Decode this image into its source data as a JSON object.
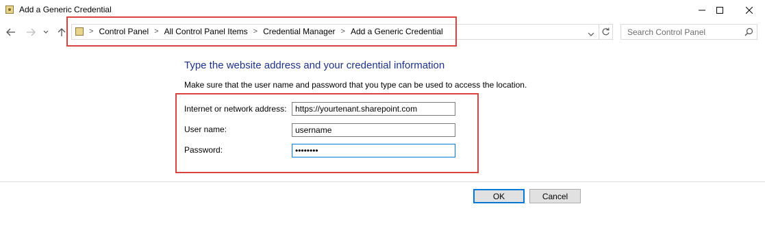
{
  "window": {
    "title": "Add a Generic Credential"
  },
  "nav": {
    "back_icon": "arrow-left-icon",
    "forward_icon": "arrow-right-icon",
    "recent_icon": "chevron-down-icon",
    "up_icon": "arrow-up-icon"
  },
  "breadcrumb": {
    "items": [
      "Control Panel",
      "All Control Panel Items",
      "Credential Manager",
      "Add a Generic Credential"
    ],
    "separator": ">"
  },
  "search": {
    "placeholder": "Search Control Panel"
  },
  "form": {
    "heading": "Type the website address and your credential information",
    "instruction": "Make sure that the user name and password that you type can be used to access the location.",
    "address_label": "Internet or network address:",
    "address_value": "https://yourtenant.sharepoint.com",
    "username_label": "User name:",
    "username_value": "username",
    "password_label": "Password:",
    "password_value": "••••••••"
  },
  "buttons": {
    "ok": "OK",
    "cancel": "Cancel"
  },
  "colors": {
    "heading": "#1e3287",
    "highlight": "#d9423f",
    "focus": "#0078d7"
  }
}
